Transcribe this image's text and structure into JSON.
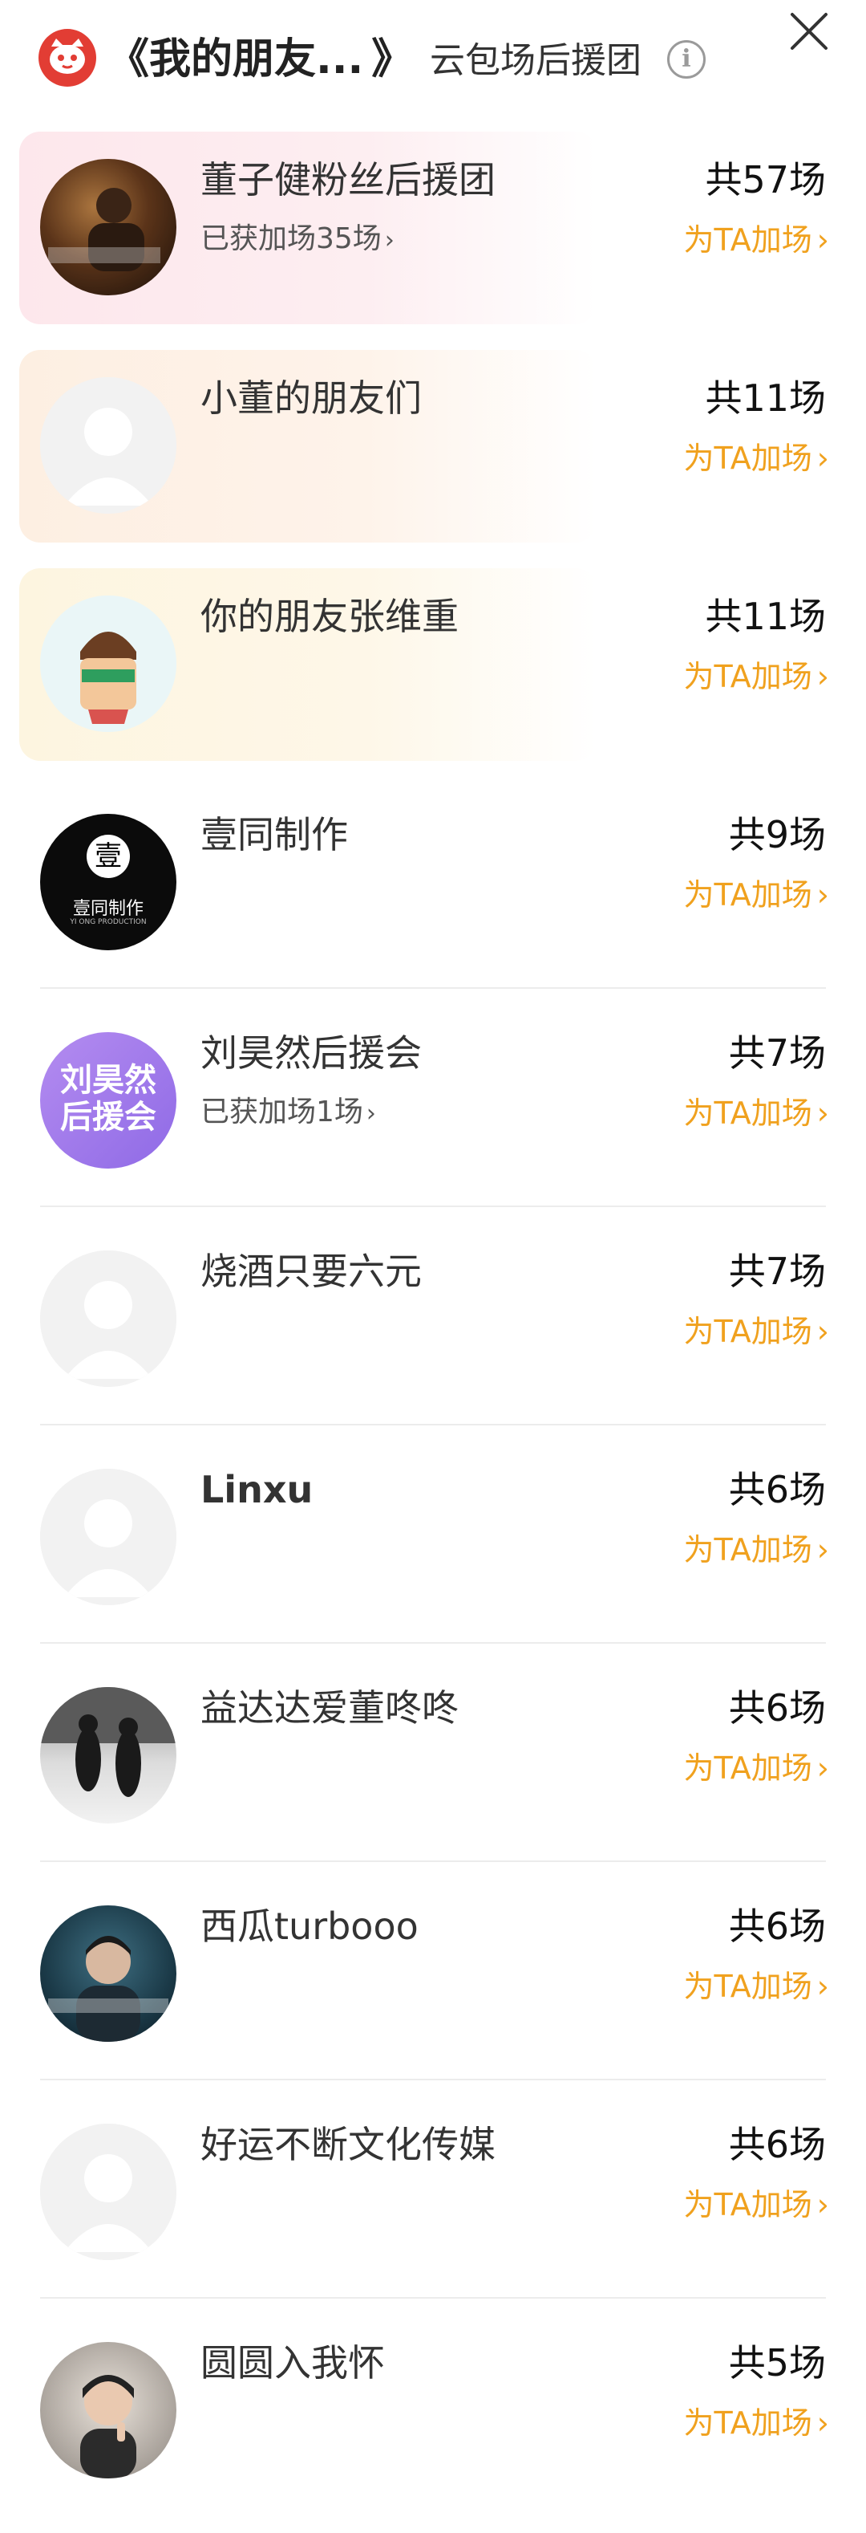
{
  "header": {
    "title": "《我的朋友...",
    "title_close": "》",
    "subtitle": "云包场后援团",
    "info_glyph": "i"
  },
  "colors": {
    "accent_orange": "#f0a11e",
    "brand_red": "#e23d34",
    "first_row_bg": "#fde7ec",
    "second_row_bg": "#fdefe2",
    "third_row_bg": "#fdf5e0"
  },
  "rows": [
    {
      "name": "董子健粉丝后援团",
      "sub": "已获加场35场",
      "count": "共57场",
      "boost": "为TA加场"
    },
    {
      "name": "小董的朋友们",
      "sub": "",
      "count": "共11场",
      "boost": "为TA加场"
    },
    {
      "name": "你的朋友张维重",
      "sub": "",
      "count": "共11场",
      "boost": "为TA加场"
    },
    {
      "name": "壹同制作",
      "sub": "",
      "count": "共9场",
      "boost": "为TA加场",
      "avatar_text": "壹同制作",
      "avatar_sub": "YI ONG PRODUCTION"
    },
    {
      "name": "刘昊然后援会",
      "sub": "已获加场1场",
      "count": "共7场",
      "boost": "为TA加场",
      "avatar_text1": "刘昊然",
      "avatar_text2": "后援会"
    },
    {
      "name": "烧酒只要六元",
      "sub": "",
      "count": "共7场",
      "boost": "为TA加场"
    },
    {
      "name": "Linxu",
      "sub": "",
      "count": "共6场",
      "boost": "为TA加场"
    },
    {
      "name": "益达达爱董咚咚",
      "sub": "",
      "count": "共6场",
      "boost": "为TA加场"
    },
    {
      "name": "西瓜turbooo",
      "sub": "",
      "count": "共6场",
      "boost": "为TA加场"
    },
    {
      "name": "好运不断文化传媒",
      "sub": "",
      "count": "共6场",
      "boost": "为TA加场"
    },
    {
      "name": "圆圆入我怀",
      "sub": "",
      "count": "共5场",
      "boost": "为TA加场"
    }
  ]
}
